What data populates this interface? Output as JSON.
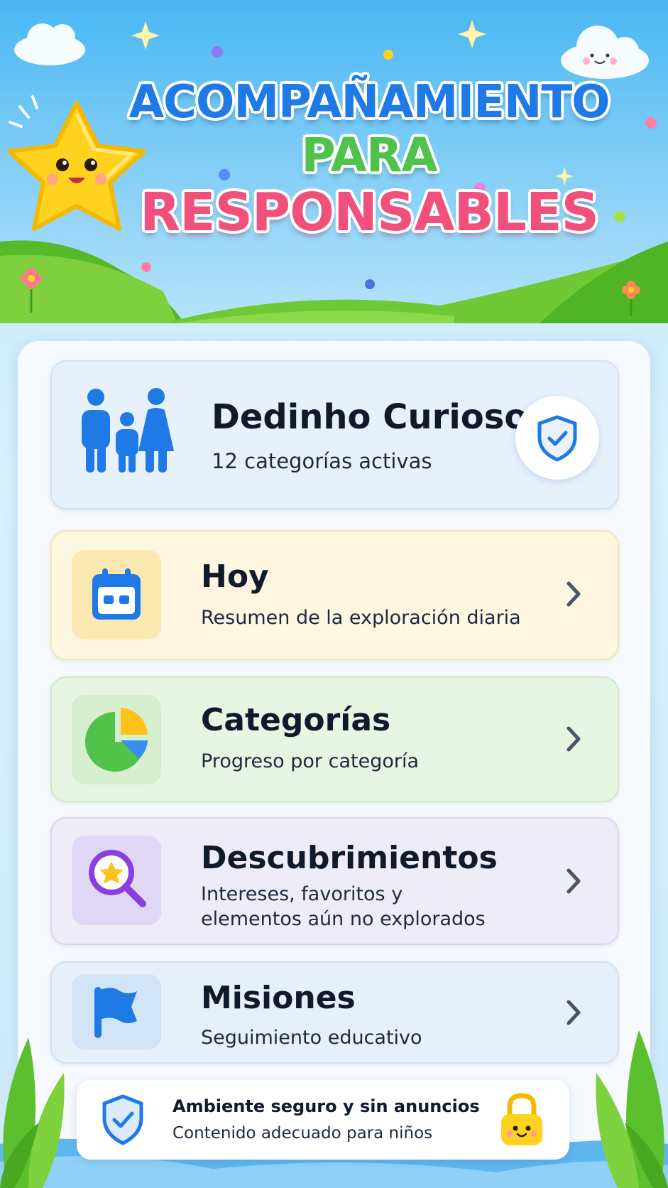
{
  "header": {
    "title_line1": "ACOMPAÑAMIENTO",
    "title_line2": "PARA",
    "title_line3": "RESPONSABLES"
  },
  "profile": {
    "name": "Dedinho Curioso",
    "subtitle": "12 categorías activas",
    "icon": "family-icon",
    "badge_icon": "shield-check-icon"
  },
  "menu": [
    {
      "title": "Hoy",
      "subtitle": "Resumen de la exploración diaria",
      "icon": "calendar-icon"
    },
    {
      "title": "Categorías",
      "subtitle": "Progreso por categoría",
      "icon": "pie-chart-icon"
    },
    {
      "title": "Descubrimientos",
      "subtitle_line1": "Intereses, favoritos y",
      "subtitle_line2": "elementos aún no explorados",
      "icon": "magnifier-star-icon"
    },
    {
      "title": "Misiones",
      "subtitle": "Seguimiento educativo",
      "icon": "flag-icon"
    }
  ],
  "safe_banner": {
    "title": "Ambiente seguro y sin anuncios",
    "subtitle": "Contenido adecuado para niños",
    "icon": "shield-check-icon",
    "lock_icon": "lock-smile-icon"
  },
  "colors": {
    "primary_blue": "#1f7ae6",
    "green": "#4fc24a",
    "pink": "#f2507c",
    "star_yellow": "#ffd21f"
  }
}
